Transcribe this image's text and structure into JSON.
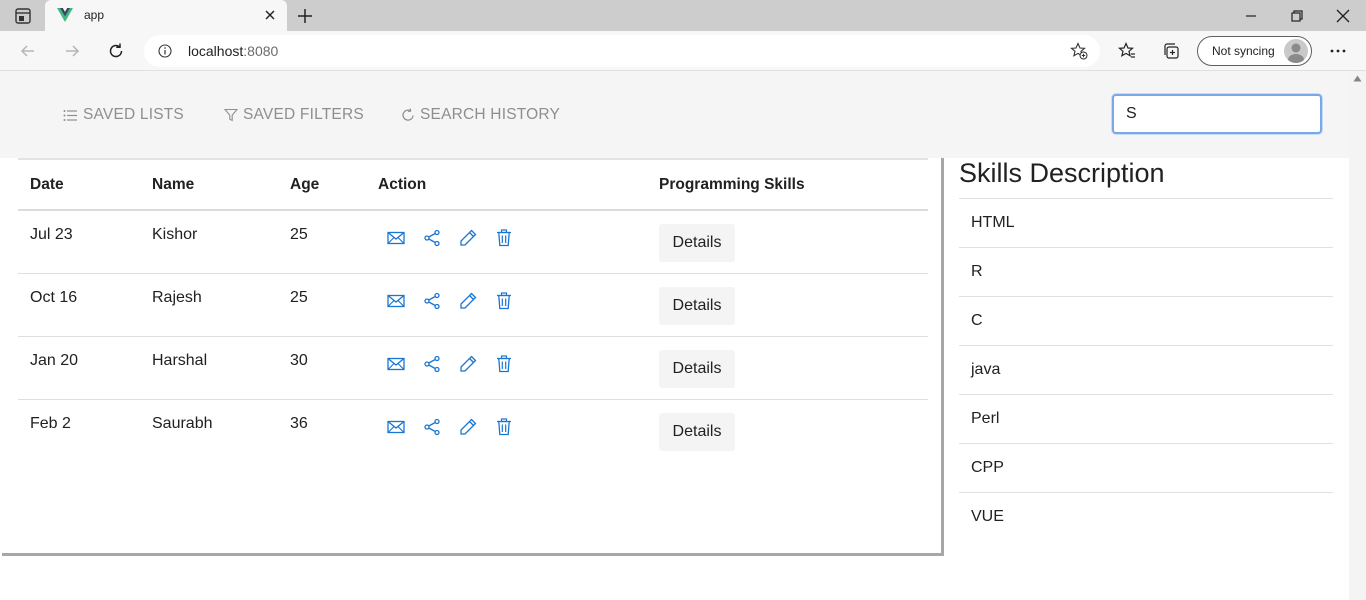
{
  "browser": {
    "tab_title": "app",
    "url_host": "localhost",
    "url_port": ":8080",
    "sync_label": "Not syncing"
  },
  "nav": {
    "saved_lists": "SAVED LISTS",
    "saved_filters": "SAVED FILTERS",
    "search_history": "SEARCH HISTORY"
  },
  "search": {
    "value": "S"
  },
  "table": {
    "headers": [
      "Date",
      "Name",
      "Age",
      "Action",
      "Programming Skills"
    ],
    "details_label": "Details",
    "rows": [
      {
        "date": "Jul 23",
        "name": "Kishor",
        "age": "25"
      },
      {
        "date": "Oct 16",
        "name": "Rajesh",
        "age": "25"
      },
      {
        "date": "Jan 20",
        "name": "Harshal",
        "age": "30"
      },
      {
        "date": "Feb 2",
        "name": "Saurabh",
        "age": "36"
      }
    ]
  },
  "skills": {
    "title": "Skills Description",
    "items": [
      "HTML",
      "R",
      "C",
      "java",
      "Perl",
      "CPP",
      "VUE"
    ]
  },
  "colors": {
    "icon_blue": "#1976d2",
    "vue_green": "#41b883",
    "vue_dark": "#35495e"
  }
}
